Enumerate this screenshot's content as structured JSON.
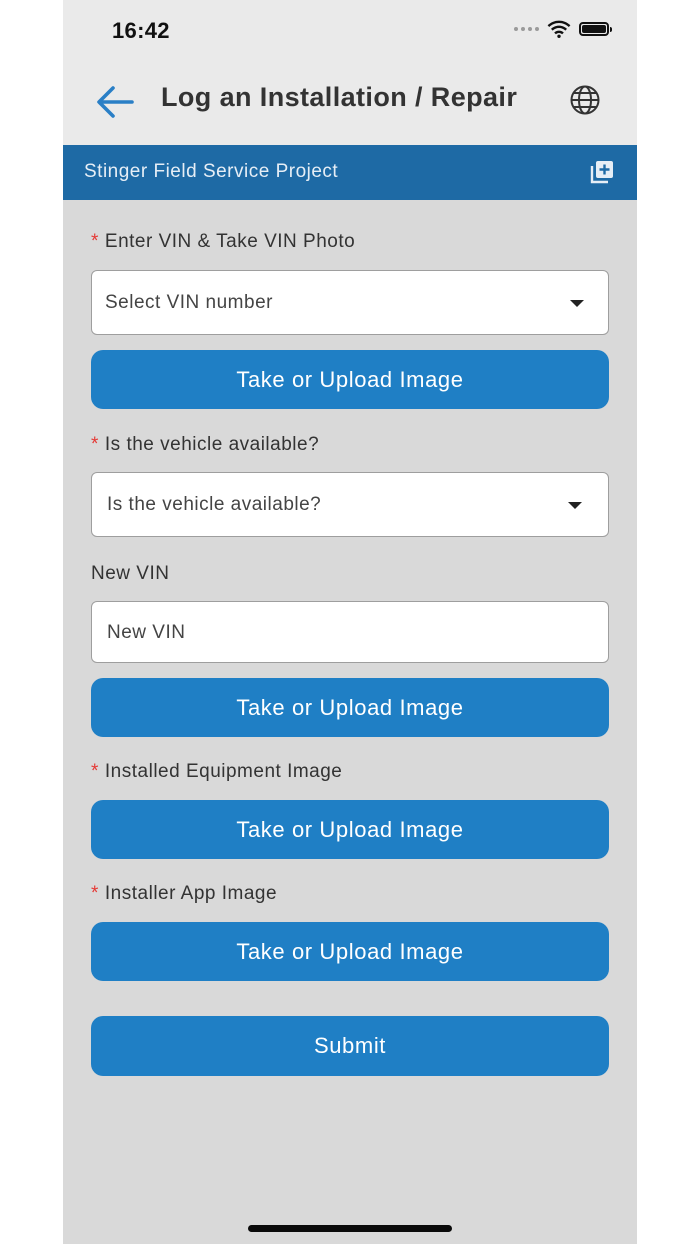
{
  "status": {
    "time": "16:42"
  },
  "navbar": {
    "title": "Log an Installation / Repair"
  },
  "project": {
    "name": "Stinger Field Service Project"
  },
  "form": {
    "vin_label": "Enter VIN & Take VIN Photo",
    "vin_select_value": "Select VIN number",
    "vehicle_available_label": "Is the vehicle available?",
    "vehicle_available_value": "Is the vehicle available?",
    "new_vin_label": "New VIN",
    "new_vin_placeholder": "New VIN",
    "installed_equipment_label": "Installed Equipment Image",
    "installer_app_label": "Installer App Image",
    "upload_button_label": "Take or Upload Image",
    "submit_label": "Submit",
    "required_marker": "*"
  },
  "colors": {
    "primary_button": "#1f7fc5",
    "project_bar": "#1e6aa5",
    "required": "#e53935",
    "back_arrow": "#2a7fc6"
  },
  "icons": {
    "back": "back-arrow-icon",
    "globe": "globe-icon",
    "add": "add-to-library-icon",
    "wifi": "wifi-icon",
    "battery": "battery-icon",
    "signal": "signal-dots-icon",
    "dropdown": "caret-down-icon"
  }
}
